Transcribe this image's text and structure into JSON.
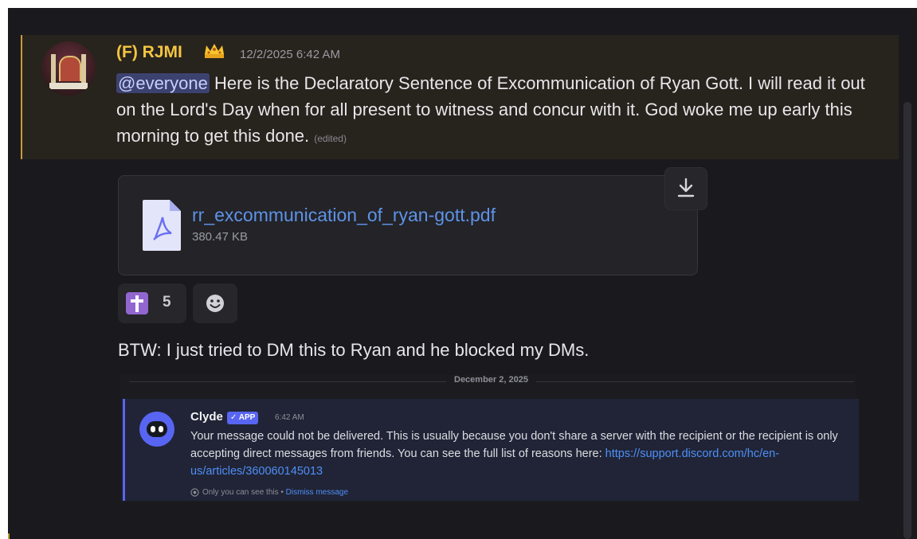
{
  "message": {
    "username": "(F) RJMI",
    "badge_icon": "crown-icon",
    "timestamp": "12/2/2025 6:42 AM",
    "mention": "@everyone",
    "text": " Here is the Declaratory Sentence of Excommunication of Ryan Gott. I will read it out on the Lord's Day when for all present to witness and concur with it. God woke me up early this morning to get this done. ",
    "edited_label": "(edited)"
  },
  "attachment": {
    "file_name": "rr_excommunication_of_ryan-gott.pdf",
    "file_size": "380.47 KB",
    "icon": "pdf-file-icon",
    "download_icon": "download-icon"
  },
  "reactions": [
    {
      "emoji": "latin-cross-icon",
      "count": "5"
    }
  ],
  "add_reaction_icon": "smiley-icon",
  "followup_text": "BTW: I just tried to DM this to Ryan and he blocked my DMs.",
  "embed": {
    "date_divider": "December 2, 2025",
    "clyde": {
      "name": "Clyde",
      "badge": "✓ APP",
      "time": "6:42 AM",
      "message": "Your message could not be delivered. This is usually because you don't share a server with the recipient or the recipient is only accepting direct messages from friends. You can see the full list of reasons here: ",
      "link": "https://support.discord.com/hc/en-us/articles/360060145013",
      "footer_only": "Only you can see this • ",
      "footer_dismiss": "Dismiss message"
    }
  },
  "colors": {
    "username": "#f4c542",
    "mention_bg": "#3c4270",
    "link": "#5e93e6",
    "highlight_bg": "#27231d",
    "blurple": "#5865f2"
  }
}
